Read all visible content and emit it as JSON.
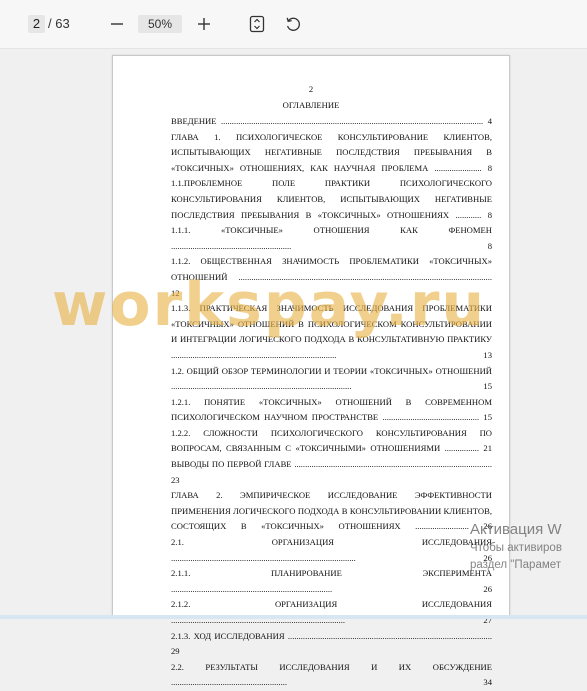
{
  "toolbar": {
    "current_page": "2",
    "total_pages": "/ 63",
    "zoom": "50%",
    "icons": [
      "minus-icon",
      "plus-icon",
      "fit-page-icon",
      "rotate-icon"
    ]
  },
  "document": {
    "page_number": "2",
    "toc_title": "ОГЛАВЛЕНИЕ",
    "entries": [
      {
        "text": "ВВЕДЕНИЕ ..........................................................................................................................  4"
      },
      {
        "text": "ГЛАВА 1. ПСИХОЛОГИЧЕСКОЕ КОНСУЛЬТИРОВАНИЕ КЛИЕНТОВ, ИСПЫТЫВАЮЩИХ НЕГАТИВНЫЕ ПОСЛЕДСТВИЯ ПРЕБЫВАНИЯ В «ТОКСИЧНЫХ» ОТНОШЕНИЯХ, КАК НАУЧНАЯ ПРОБЛЕМА ...................... 8"
      },
      {
        "text": "1.1.ПРОБЛЕМНОЕ ПОЛЕ ПРАКТИКИ ПСИХОЛОГИЧЕСКОГО КОНСУЛЬТИРОВАНИЯ КЛИЕНТОВ, ИСПЫТЫВАЮЩИХ НЕГАТИВНЫЕ ПОСЛЕДСТВИЯ ПРЕБЫВАНИЯ В «ТОКСИЧНЫХ» ОТНОШЕНИЯХ ............ 8"
      },
      {
        "text": "1.1.1. «ТОКСИЧНЫЕ» ОТНОШЕНИЯ КАК ФЕНОМЕН ........................................................ 8"
      },
      {
        "text": "1.1.2. ОБЩЕСТВЕННАЯ ЗНАЧИМОСТЬ ПРОБЛЕМАТИКИ «ТОКСИЧНЫХ» ОТНОШЕНИЙ ...................................................................................................................... 12"
      },
      {
        "text": "1.1.3. ПРАКТИЧЕСКАЯ ЗНАЧИМОСТЬ ИССЛЕДОВАНИЯ ПРОБЛЕМАТИКИ «ТОКСИЧНЫХ» ОТНОШЕНИЙ В ПСИХОЛОГИЧЕСКОМ КОНСУЛЬТИРОВАНИИ И ИНТЕГРАЦИИ ЛОГИЧЕСКОГО ПОДХОДА В КОНСУЛЬТАТИВНУЮ ПРАКТИКУ ............................................................................. 13"
      },
      {
        "text": "1.2. ОБЩИЙ ОБЗОР ТЕРМИНОЛОГИИ И ТЕОРИИ «ТОКСИЧНЫХ» ОТНОШЕНИЙ .................................................................................... 15"
      },
      {
        "text": "1.2.1. ПОНЯТИЕ «ТОКСИЧНЫХ» ОТНОШЕНИЙ В СОВРЕМЕННОМ ПСИХОЛОГИЧЕСКОМ НАУЧНОМ ПРОСТРАНСТВЕ ............................................. 15"
      },
      {
        "text": "1.2.2. СЛОЖНОСТИ ПСИХОЛОГИЧЕСКОГО КОНСУЛЬТИРОВАНИЯ ПО ВОПРОСАМ, СВЯЗАННЫМ С «ТОКСИЧНЫМИ» ОТНОШЕНИЯМИ ................ 21"
      },
      {
        "text": "ВЫВОДЫ ПО ПЕРВОЙ ГЛАВЕ ............................................................................................ 23"
      },
      {
        "text": "ГЛАВА 2. ЭМПИРИЧЕСКОЕ ИССЛЕДОВАНИЕ ЭФФЕКТИВНОСТИ ПРИМЕНЕНИЯ ЛОГИЧЕСКОГО ПОДХОДА В КОНСУЛЬТИРОВАНИИ КЛИЕНТОВ, СОСТОЯЩИХ В «ТОКСИЧНЫХ» ОТНОШЕНИЯХ ......................... 26"
      },
      {
        "text": "2.1. ОРГАНИЗАЦИЯ ИССЛЕДОВАНИЯ ...................................................................................... 26"
      },
      {
        "text": "2.1.1. ПЛАНИРОВАНИЕ ЭКСПЕРИМЕНТА ........................................................................... 26"
      },
      {
        "text": "2.1.2. ОРГАНИЗАЦИЯ ИССЛЕДОВАНИЯ ................................................................................. 27"
      },
      {
        "text": "2.1.3. ХОД ИССЛЕДОВАНИЯ ............................................................................................... 29"
      },
      {
        "text": "2.2. РЕЗУЛЬТАТЫ ИССЛЕДОВАНИЯ И ИХ ОБСУЖДЕНИЕ ...................................................... 34"
      }
    ]
  },
  "watermark": "workspay.ru",
  "activation": {
    "title": "Активация W",
    "line1": "Чтобы активиров",
    "line2": "раздел \"Парамет"
  },
  "colors": {
    "toolbar_bg": "#f7f7f7",
    "viewer_bg": "#f0f0f0",
    "watermark": "#e8b246"
  }
}
